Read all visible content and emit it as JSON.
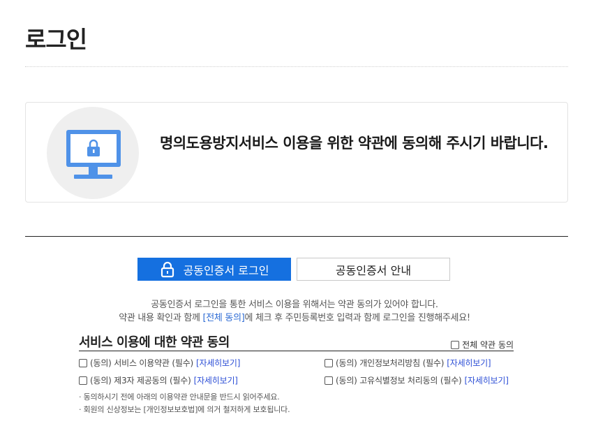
{
  "header": {
    "title": "로그인"
  },
  "notice": {
    "text": "명의도용방지서비스 이용을 위한 약관에 동의해 주시기 바랍니다."
  },
  "tabs": {
    "login_label": "공동인증서 로그인",
    "guide_label": "공동인증서 안내"
  },
  "description": {
    "line1": "공동인증서 로그인을 통한 서비스 이용을 위해서는 약관 동의가 있어야 합니다.",
    "line2_before": "약관 내용 확인과 함께 ",
    "line2_highlight": "[전체 동의]",
    "line2_after": "에 체크 후 주민등록번호 입력과 함께 로그인을 진행해주세요!"
  },
  "terms": {
    "title": "서비스 이용에 대한 약관 동의",
    "all_agree_label": "전체 약관 동의",
    "items": [
      {
        "label": "(동의) 서비스 이용약관 (필수)",
        "detail": "[자세히보기]",
        "checked": false
      },
      {
        "label": "(동의) 개인정보처리방침 (필수)",
        "detail": "[자세히보기]",
        "checked": false
      },
      {
        "label": "(동의) 제3자 제공동의 (필수)",
        "detail": "[자세히보기]",
        "checked": false
      },
      {
        "label": "(동의) 고유식별정보 처리동의 (필수)",
        "detail": "[자세히보기]",
        "checked": false
      }
    ],
    "notes": [
      "· 동의하시기 전에 아래의 이용약관 안내문을 반드시 읽어주세요.",
      "· 회원의 신상정보는 [개인정보보호법]에 의거 철저하게 보호됩니다."
    ]
  },
  "colors": {
    "primary": "#1570e0",
    "link": "#2d4fd6",
    "icon": "#4f92e8"
  },
  "icons": {
    "notice": "monitor-lock-icon",
    "login_tab": "lock-icon"
  }
}
